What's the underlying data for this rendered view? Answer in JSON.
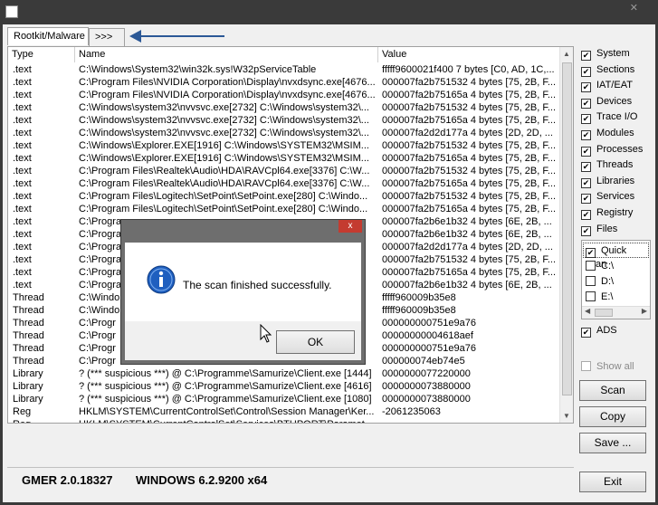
{
  "tabs": {
    "rootkit": "Rootkit/Malware",
    "more": ">>>"
  },
  "table": {
    "headers": {
      "type": "Type",
      "name": "Name",
      "value": "Value"
    },
    "rows": [
      {
        "type": ".text",
        "name": "C:\\Windows\\System32\\win32k.sys!W32pServiceTable",
        "value": "fffff9600021f400 7 bytes [C0, AD, 1C,..."
      },
      {
        "type": ".text",
        "name": "C:\\Program Files\\NVIDIA Corporation\\Display\\nvxdsync.exe[4676...",
        "value": "000007fa2b751532 4 bytes [75, 2B, F..."
      },
      {
        "type": ".text",
        "name": "C:\\Program Files\\NVIDIA Corporation\\Display\\nvxdsync.exe[4676...",
        "value": "000007fa2b75165a 4 bytes [75, 2B, F..."
      },
      {
        "type": ".text",
        "name": "C:\\Windows\\system32\\nvvsvc.exe[2732] C:\\Windows\\system32\\...",
        "value": "000007fa2b751532 4 bytes [75, 2B, F..."
      },
      {
        "type": ".text",
        "name": "C:\\Windows\\system32\\nvvsvc.exe[2732] C:\\Windows\\system32\\...",
        "value": "000007fa2b75165a 4 bytes [75, 2B, F..."
      },
      {
        "type": ".text",
        "name": "C:\\Windows\\system32\\nvvsvc.exe[2732] C:\\Windows\\system32\\...",
        "value": "000007fa2d2d177a 4 bytes [2D, 2D, ..."
      },
      {
        "type": ".text",
        "name": "C:\\Windows\\Explorer.EXE[1916] C:\\Windows\\SYSTEM32\\MSIM...",
        "value": "000007fa2b751532 4 bytes [75, 2B, F..."
      },
      {
        "type": ".text",
        "name": "C:\\Windows\\Explorer.EXE[1916] C:\\Windows\\SYSTEM32\\MSIM...",
        "value": "000007fa2b75165a 4 bytes [75, 2B, F..."
      },
      {
        "type": ".text",
        "name": "C:\\Program Files\\Realtek\\Audio\\HDA\\RAVCpl64.exe[3376] C:\\W...",
        "value": "000007fa2b751532 4 bytes [75, 2B, F..."
      },
      {
        "type": ".text",
        "name": "C:\\Program Files\\Realtek\\Audio\\HDA\\RAVCpl64.exe[3376] C:\\W...",
        "value": "000007fa2b75165a 4 bytes [75, 2B, F..."
      },
      {
        "type": ".text",
        "name": "C:\\Program Files\\Logitech\\SetPoint\\SetPoint.exe[280] C:\\Windo...",
        "value": "000007fa2b751532 4 bytes [75, 2B, F..."
      },
      {
        "type": ".text",
        "name": "C:\\Program Files\\Logitech\\SetPoint\\SetPoint.exe[280] C:\\Windo...",
        "value": "000007fa2b75165a 4 bytes [75, 2B, F..."
      },
      {
        "type": ".text",
        "name": "C:\\Program",
        "value": "000007fa2b6e1b32 4 bytes [6E, 2B, ..."
      },
      {
        "type": ".text",
        "name": "C:\\Program",
        "value": "000007fa2b6e1b32 4 bytes [6E, 2B, ..."
      },
      {
        "type": ".text",
        "name": "C:\\Program",
        "value": "000007fa2d2d177a 4 bytes [2D, 2D, ..."
      },
      {
        "type": ".text",
        "name": "C:\\Program",
        "value": "000007fa2b751532 4 bytes [75, 2B, F..."
      },
      {
        "type": ".text",
        "name": "C:\\Program",
        "value": "000007fa2b75165a 4 bytes [75, 2B, F..."
      },
      {
        "type": ".text",
        "name": "C:\\Program",
        "value": "000007fa2b6e1b32 4 bytes [6E, 2B, ..."
      },
      {
        "type": "Thread",
        "name": "C:\\Windo",
        "value": "fffff960009b35e8"
      },
      {
        "type": "Thread",
        "name": "C:\\Windo",
        "value": "fffff960009b35e8"
      },
      {
        "type": "Thread",
        "name": "C:\\Progr",
        "value": "000000000751e9a76"
      },
      {
        "type": "Thread",
        "name": "C:\\Progr",
        "value": "00000000004618aef"
      },
      {
        "type": "Thread",
        "name": "C:\\Progr",
        "value": "000000000751e9a76"
      },
      {
        "type": "Thread",
        "name": "C:\\Progr",
        "value": "000000074eb74e5"
      },
      {
        "type": "Library",
        "name": "? (*** suspicious ***) @ C:\\Programme\\Samurize\\Client.exe [1444]",
        "value": "0000000077220000"
      },
      {
        "type": "Library",
        "name": "? (*** suspicious ***) @ C:\\Programme\\Samurize\\Client.exe [4616]",
        "value": "0000000073880000"
      },
      {
        "type": "Library",
        "name": "? (*** suspicious ***) @ C:\\Programme\\Samurize\\Client.exe [1080]",
        "value": "0000000073880000"
      },
      {
        "type": "Reg",
        "name": "HKLM\\SYSTEM\\CurrentControlSet\\Control\\Session Manager\\Ker...",
        "value": "-2061235063"
      },
      {
        "type": "Reg",
        "name": "HKLM\\SYSTEM\\CurrentControlSet\\Services\\BTHPORT\\Paramet...",
        "value": ""
      }
    ]
  },
  "options": [
    {
      "label": "System",
      "checked": true
    },
    {
      "label": "Sections",
      "checked": true
    },
    {
      "label": "IAT/EAT",
      "checked": true
    },
    {
      "label": "Devices",
      "checked": true
    },
    {
      "label": "Trace I/O",
      "checked": true
    },
    {
      "label": "Modules",
      "checked": true
    },
    {
      "label": "Processes",
      "checked": true
    },
    {
      "label": "Threads",
      "checked": true
    },
    {
      "label": "Libraries",
      "checked": true
    },
    {
      "label": "Services",
      "checked": true
    },
    {
      "label": "Registry",
      "checked": true
    },
    {
      "label": "Files",
      "checked": true
    }
  ],
  "files_list": [
    {
      "label": "Quick scan",
      "checked": true
    },
    {
      "label": "C:\\",
      "checked": false
    },
    {
      "label": "D:\\",
      "checked": false
    },
    {
      "label": "E:\\",
      "checked": false
    }
  ],
  "ads": {
    "label": "ADS",
    "checked": true
  },
  "show_all": {
    "label": "Show all",
    "checked": false
  },
  "buttons": {
    "scan": "Scan",
    "copy": "Copy",
    "save": "Save ...",
    "exit": "Exit"
  },
  "dialog": {
    "message": "The scan finished successfully.",
    "ok": "OK",
    "close": "x"
  },
  "status": {
    "version": "GMER 2.0.18327",
    "os": "WINDOWS 6.2.9200  x64"
  },
  "colors": {
    "titlebar": "#3a3a3a",
    "arrow": "#2b5896",
    "dialog_close": "#c43b30",
    "info_icon": "#1f5fbf"
  }
}
